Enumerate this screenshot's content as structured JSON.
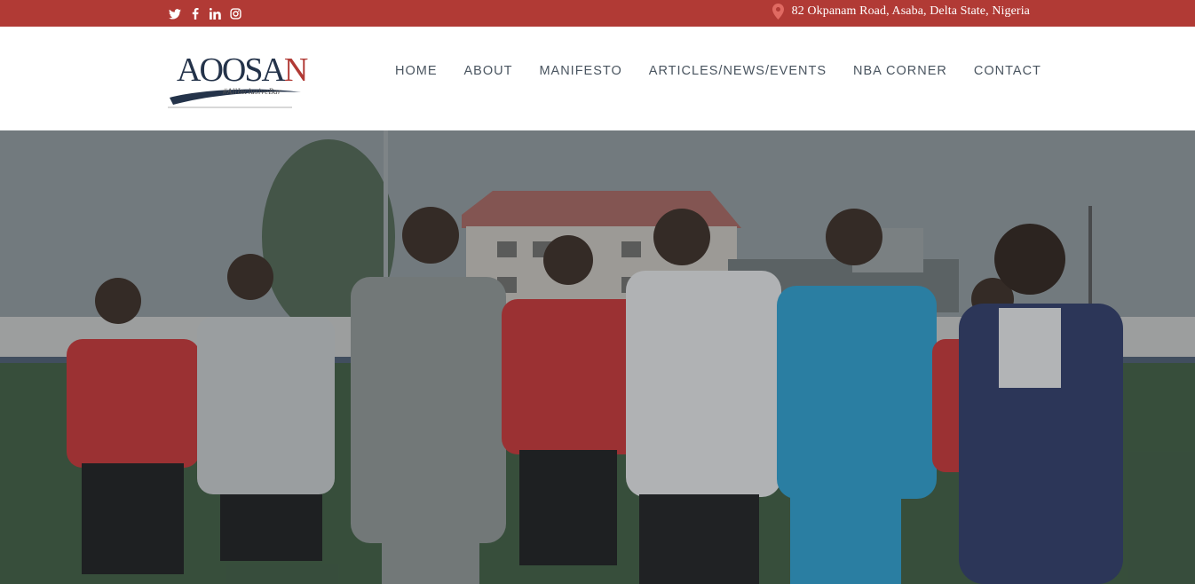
{
  "topbar": {
    "social_icons": [
      "twitter-icon",
      "facebook-icon",
      "linkedin-icon",
      "instagram-icon"
    ],
    "address_icon": "map-pin-icon",
    "address": "82 Okpanam Road, Asaba, Delta State, Nigeria",
    "bg_color": "#b13a35"
  },
  "header": {
    "logo": {
      "text_main": "AOOSA",
      "text_accent": "N",
      "tagline": "#AllInclusiveBar"
    },
    "nav": [
      {
        "label": "HOME"
      },
      {
        "label": "ABOUT"
      },
      {
        "label": "MANIFESTO"
      },
      {
        "label": "ARTICLES/NEWS/EVENTS"
      },
      {
        "label": "NBA CORNER"
      },
      {
        "label": "CONTACT"
      }
    ]
  },
  "hero": {
    "image_subject": "group-photo-football-pitch"
  }
}
